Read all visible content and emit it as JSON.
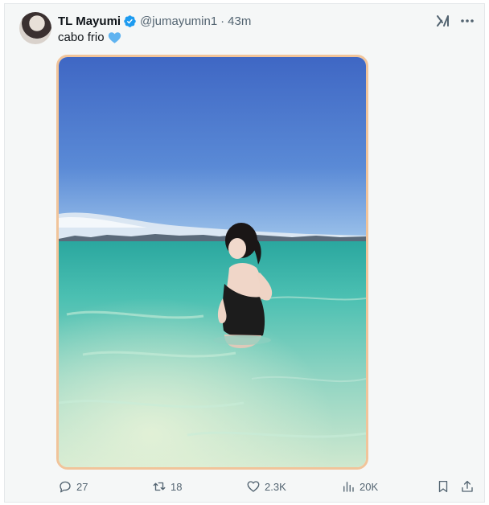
{
  "post": {
    "display_name": "TL Mayumi",
    "handle": "@jumayumin1",
    "separator": "·",
    "time": "43m",
    "text": "cabo frio",
    "emoji": "blue-heart",
    "verified": true
  },
  "actions": {
    "replies": "27",
    "reposts": "18",
    "likes": "2.3K",
    "views": "20K"
  },
  "colors": {
    "verified_blue": "#1d9bf0",
    "muted_text": "#536471",
    "media_border": "#f1c49a",
    "heart_blue": "#5fb3f0"
  },
  "icons": [
    "grok-icon",
    "more-icon",
    "reply-icon",
    "retweet-icon",
    "like-icon",
    "views-icon",
    "bookmark-icon",
    "share-icon"
  ]
}
